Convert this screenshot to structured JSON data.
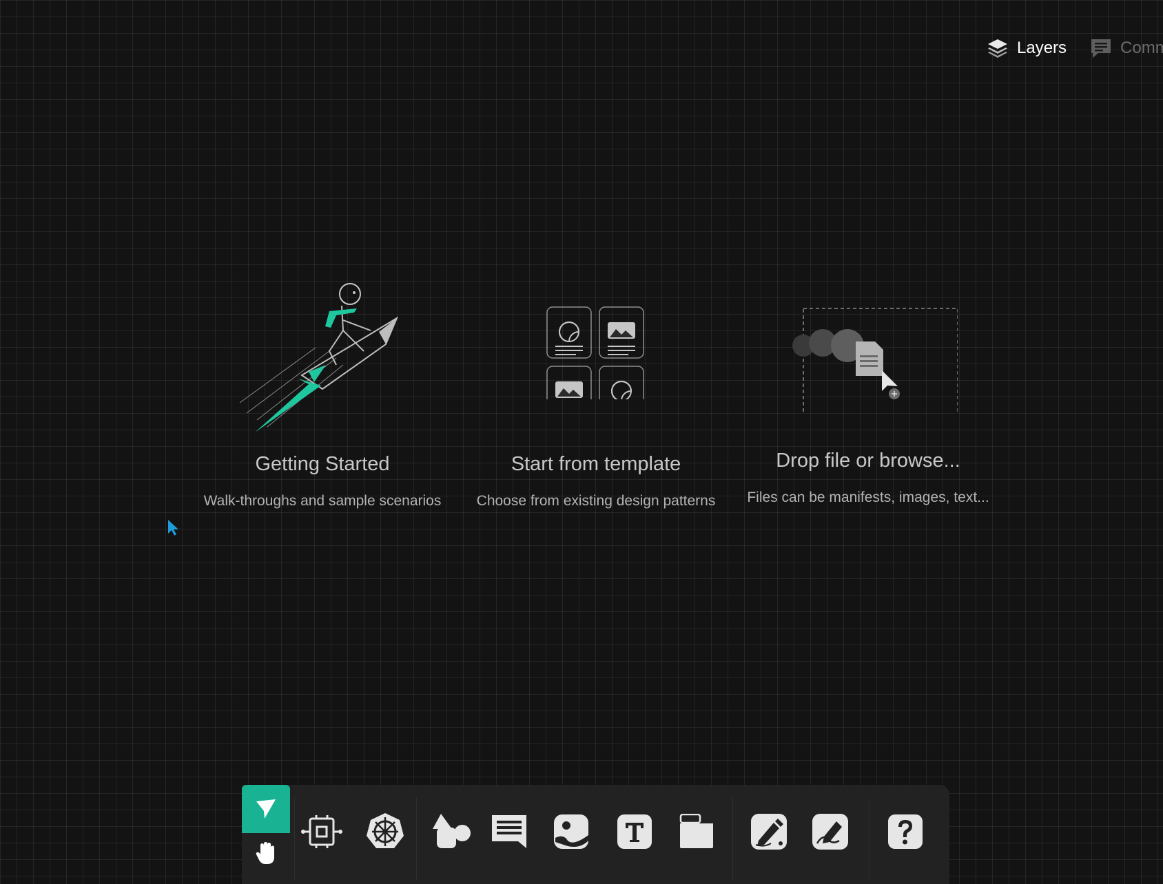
{
  "topbar": {
    "layers_label": "Layers",
    "comments_label": "Comm"
  },
  "cards": {
    "getting_started": {
      "title": "Getting Started",
      "subtitle": "Walk-throughs and sample scenarios"
    },
    "template": {
      "title": "Start from template",
      "subtitle": "Choose from existing design patterns"
    },
    "drop": {
      "title": "Drop file or browse...",
      "subtitle": "Files can be manifests, images, text..."
    }
  },
  "toolbar": {
    "tools": [
      "select-icon",
      "pan-hand-icon",
      "component-icon",
      "kubernetes-icon",
      "shapes-icon",
      "comment-icon",
      "image-icon",
      "text-icon",
      "section-icon",
      "pen-icon",
      "freehand-icon",
      "help-icon"
    ],
    "active_tool": "select-icon"
  },
  "colors": {
    "accent": "#19b394",
    "background": "#131313",
    "toolbar": "#222222",
    "icon": "#e6e6e6"
  }
}
